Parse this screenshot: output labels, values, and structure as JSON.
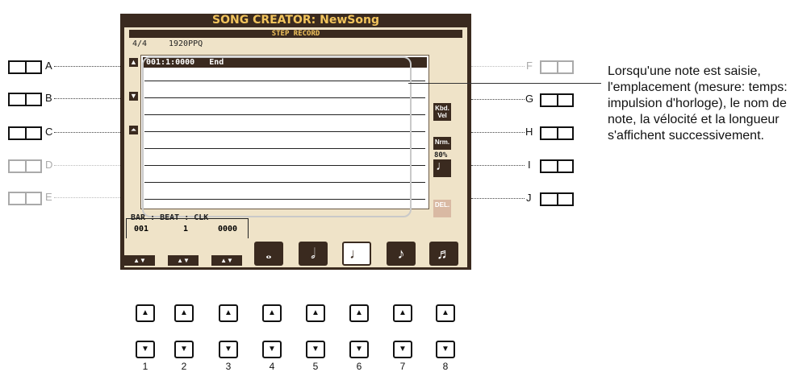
{
  "screen": {
    "title": "SONG CREATOR: NewSong",
    "mode": "STEP RECORD",
    "time_signature": "4/4",
    "resolution": "1920PPQ",
    "first_event": "001:1:0000   End",
    "position_header": "BAR : BEAT : CLK",
    "bar": "001",
    "beat": "1",
    "clk": "0000",
    "kbd_vel_label": "Kbd. Vel",
    "nrm_label": "Nrm.",
    "gate_percent": "80%",
    "del_label": "DEL.",
    "arrow_updown": "▲▼",
    "note_buttons": [
      "𝅝",
      "𝅗𝅥",
      "♩",
      "♪",
      "♬"
    ]
  },
  "side_labels": {
    "A": "A",
    "B": "B",
    "C": "C",
    "D": "D",
    "E": "E",
    "F": "F",
    "G": "G",
    "H": "H",
    "I": "I",
    "J": "J"
  },
  "bottom_buttons": {
    "up": "▲",
    "down": "▼",
    "numbers": [
      "1",
      "2",
      "3",
      "4",
      "5",
      "6",
      "7",
      "8"
    ]
  },
  "callout_text": "Lorsqu'une note est saisie, l'emplacement (mesure: temps: impulsion d'horloge), le nom de note, la vélocité et la longueur s'affichent successivement."
}
